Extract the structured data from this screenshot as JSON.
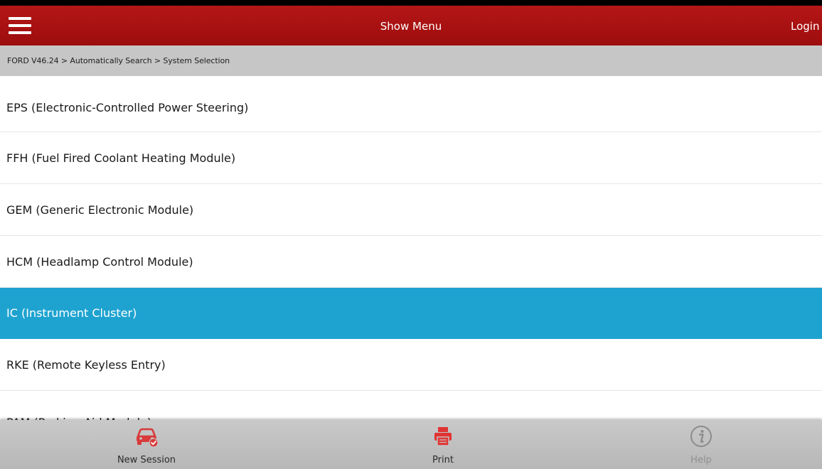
{
  "header": {
    "title": "Show Menu",
    "login_label": "Login",
    "menu_icon": "hamburger-menu-icon",
    "background_color": "#a91010"
  },
  "breadcrumb": {
    "text": "FORD V46.24 > Automatically Search > System Selection"
  },
  "systems": [
    {
      "label": "EPS (Electronic-Controlled Power Steering)",
      "selected": false
    },
    {
      "label": "FFH (Fuel Fired Coolant Heating Module)",
      "selected": false
    },
    {
      "label": "GEM (Generic Electronic Module)",
      "selected": false
    },
    {
      "label": "HCM (Headlamp Control Module)",
      "selected": false
    },
    {
      "label": "IC (Instrument Cluster)",
      "selected": true
    },
    {
      "label": "RKE (Remote Keyless Entry)",
      "selected": false
    },
    {
      "label": "PAM (Parking Aid Module)",
      "selected": false
    }
  ],
  "selection_color": "#1ea3d0",
  "bottom_bar": {
    "new_session": {
      "label": "New Session",
      "icon": "car-check-icon",
      "color": "#d93a3a"
    },
    "print": {
      "label": "Print",
      "icon": "printer-icon",
      "color": "#e03434"
    },
    "help": {
      "label": "Help",
      "icon": "info-icon",
      "enabled": false
    }
  }
}
